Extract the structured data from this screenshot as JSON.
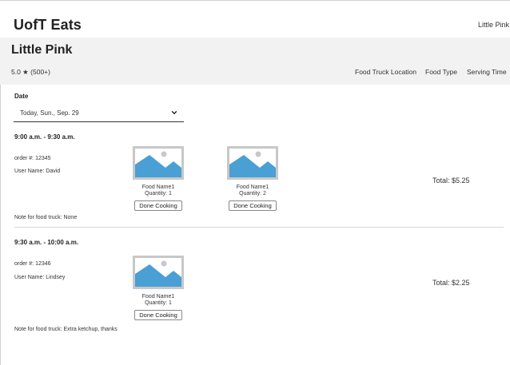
{
  "app": {
    "title": "UofT Eats",
    "top_link": "Little Pink"
  },
  "truck": {
    "name": "Little Pink",
    "rating": "5.0 ★ (500+)",
    "nav": [
      "Food Truck Location",
      "Food Type",
      "Serving Time"
    ]
  },
  "date": {
    "label": "Date",
    "selected": "Today, Sun., Sep. 29"
  },
  "orders": [
    {
      "slot": "9:00 a.m. - 9:30 a.m.",
      "order": "order #: 12345",
      "user": "User Name: David",
      "items": [
        {
          "name": "Food Name1",
          "quantity": "Quantity: 1",
          "button": "Done Cooking"
        },
        {
          "name": "Food Name1",
          "quantity": "Quantity: 2",
          "button": "Done Cooking"
        }
      ],
      "total": "Total: $5.25",
      "note": "Note for food truck: None"
    },
    {
      "slot": "9:30 a.m. - 10:00 a.m.",
      "order": "order #: 12346",
      "user": "User Name: Lindsey",
      "items": [
        {
          "name": "Food Name1",
          "quantity": "Quantity: 1",
          "button": "Done Cooking"
        }
      ],
      "total": "Total: $2.25",
      "note": "Note for food truck: Extra ketchup, thanks"
    }
  ],
  "colors": {
    "image_placeholder": "#4a9fd4",
    "header_band": "#f2f2f2"
  },
  "icons": {
    "thumbnail": "image-placeholder-icon",
    "dropdown": "chevron-down-icon"
  }
}
